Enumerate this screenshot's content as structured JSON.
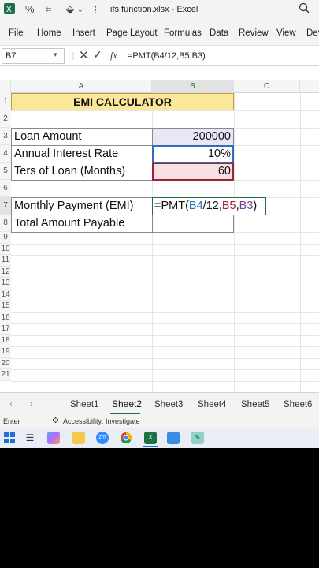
{
  "titlebar": {
    "title": "ifs function.xlsx  -  Excel"
  },
  "ribbon": {
    "tabs": [
      "File",
      "Home",
      "Insert",
      "Page Layout",
      "Formulas",
      "Data",
      "Review",
      "View",
      "Dev"
    ]
  },
  "formula_bar": {
    "name_box": "B7",
    "fx": "fx",
    "content": "=PMT(B4/12,B5,B3)"
  },
  "columns": [
    "A",
    "B",
    "C"
  ],
  "rows": [
    "1",
    "2",
    "3",
    "4",
    "5",
    "6",
    "7",
    "8",
    "9",
    "10",
    "11",
    "12",
    "13",
    "14",
    "15",
    "16",
    "17",
    "18",
    "19",
    "20",
    "21"
  ],
  "sheet": {
    "title": "EMI CALCULATOR",
    "loan_amount_label": "Loan Amount",
    "loan_amount_value": "200000",
    "rate_label": "Annual Interest Rate",
    "rate_value": "10%",
    "term_label": "Ters of Loan (Months)",
    "term_value": "60",
    "emi_label": "Monthly Payment (EMI)",
    "emi_formula_parts": [
      "=PMT(",
      "B4",
      "/12,",
      "B5",
      ",",
      "B3",
      ")"
    ],
    "total_label": "Total Amount Payable"
  },
  "sheet_tabs": [
    "Sheet1",
    "Sheet2",
    "Sheet3",
    "Sheet4",
    "Sheet5",
    "Sheet6"
  ],
  "active_sheet": "Sheet2",
  "status": {
    "mode": "Enter",
    "accessibility": "Accessibility: Investigate"
  },
  "colors": {
    "title_fill": "#fbe79a",
    "amount_fill": "#e9e6f7",
    "term_fill": "#f8e0e2",
    "ref_b4": "#2f6fb5",
    "ref_b5": "#a0223a",
    "ref_b3": "#7a3f9c",
    "accent": "#1e7145"
  }
}
